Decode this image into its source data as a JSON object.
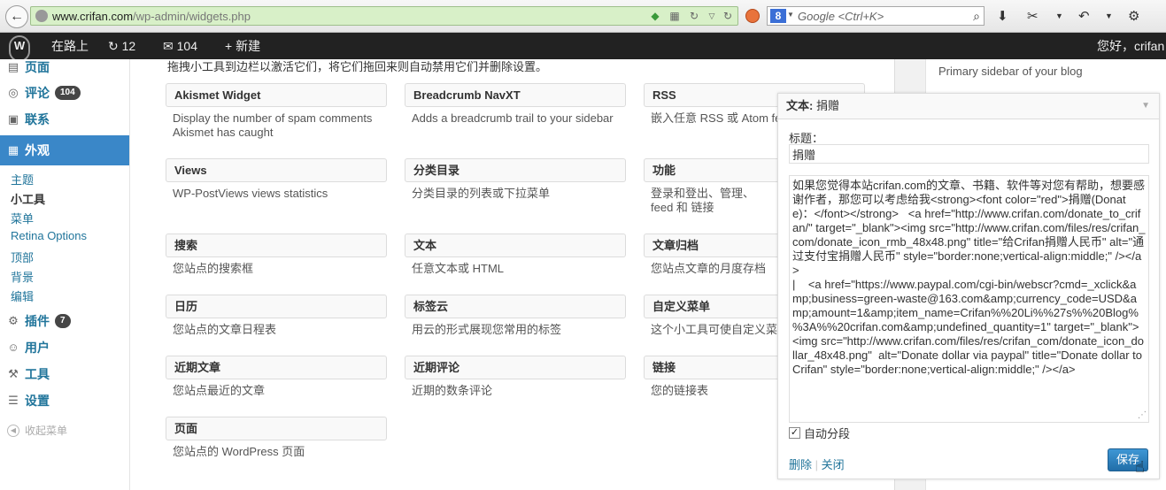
{
  "browser": {
    "url_host": "www.crifan.com",
    "url_path": "/wp-admin/widgets.php",
    "search_engine_icon": "8",
    "search_placeholder": "Google <Ctrl+K>"
  },
  "adminbar": {
    "site_name": "在路上",
    "updates_count": "12",
    "comments_count": "104",
    "new_label": "新建",
    "howdy": "您好，crifan"
  },
  "sidebar": {
    "items": [
      {
        "label": "页面",
        "icon": "page-icon"
      },
      {
        "label": "评论",
        "icon": "comment-icon",
        "badge": "104"
      },
      {
        "label": "联系",
        "icon": "contact-icon"
      },
      {
        "label": "外观",
        "icon": "appearance-icon"
      },
      {
        "label": "插件",
        "icon": "plugin-icon",
        "badge": "7"
      },
      {
        "label": "用户",
        "icon": "users-icon"
      },
      {
        "label": "工具",
        "icon": "tools-icon"
      },
      {
        "label": "设置",
        "icon": "settings-icon"
      }
    ],
    "submenu": [
      "主题",
      "小工具",
      "菜单",
      "Retina Options",
      "顶部",
      "背景",
      "编辑"
    ],
    "collapse_label": "收起菜单"
  },
  "main": {
    "intro": "拖拽小工具到边栏以激活它们，将它们拖回来则自动禁用它们并删除设置。",
    "widgets": [
      {
        "title": "Akismet Widget",
        "desc": "Display the number of spam comments Akismet has caught"
      },
      {
        "title": "Breadcrumb NavXT",
        "desc": "Adds a breadcrumb trail to your sidebar"
      },
      {
        "title": "RSS",
        "desc": "嵌入任意 RSS 或 Atom fee"
      },
      {
        "title": "Views",
        "desc": "WP-PostViews views statistics"
      },
      {
        "title": "分类目录",
        "desc": "分类目录的列表或下拉菜单"
      },
      {
        "title": "功能",
        "desc": "登录和登出、管理、feed 和 链接"
      },
      {
        "title": "搜索",
        "desc": "您站点的搜索框"
      },
      {
        "title": "文本",
        "desc": "任意文本或 HTML"
      },
      {
        "title": "文章归档",
        "desc": "您站点文章的月度存档"
      },
      {
        "title": "日历",
        "desc": "您站点的文章日程表"
      },
      {
        "title": "标签云",
        "desc": "用云的形式展现您常用的标签"
      },
      {
        "title": "自定义菜单",
        "desc": "这个小工具可使自定义菜单"
      },
      {
        "title": "近期文章",
        "desc": "您站点最近的文章"
      },
      {
        "title": "近期评论",
        "desc": "近期的数条评论"
      },
      {
        "title": "链接",
        "desc": "您的链接表"
      },
      {
        "title": "页面",
        "desc": "您站点的 WordPress 页面"
      }
    ]
  },
  "right": {
    "sidebar_desc": "Primary sidebar of your blog"
  },
  "panel": {
    "header_prefix": "文本:",
    "header_name": "捐赠",
    "title_label": "标题：",
    "title_value": "捐赠",
    "content": "如果您觉得本站crifan.com的文章、书籍、软件等对您有帮助，想要感谢作者，那您可以考虑给我<strong><font color=\"red\">捐赠(Donate)：</font></strong>   <a href=\"http://www.crifan.com/donate_to_crifan/\" target=\"_blank\"><img src=\"http://www.crifan.com/files/res/crifan_com/donate_icon_rmb_48x48.png\" title=\"给Crifan捐赠人民币\" alt=\"通过支付宝捐赠人民币\" style=\"border:none;vertical-align:middle;\" /></a>\n|    <a href=\"https://www.paypal.com/cgi-bin/webscr?cmd=_xclick&amp;business=green-waste@163.com&amp;currency_code=USD&amp;amount=1&amp;item_name=Crifan%%20Li%%27s%%20Blog%%3A%%20crifan.com&amp;undefined_quantity=1\" target=\"_blank\"><img src=\"http://www.crifan.com/files/res/crifan_com/donate_icon_dollar_48x48.png\"  alt=\"Donate dollar via paypal\" title=\"Donate dollar to Crifan\" style=\"border:none;vertical-align:middle;\" /></a>",
    "autop_label": "自动分段",
    "autop_checked": true,
    "delete_label": "删除",
    "separator": "|",
    "close_label": "关闭",
    "save_label": "保存"
  }
}
